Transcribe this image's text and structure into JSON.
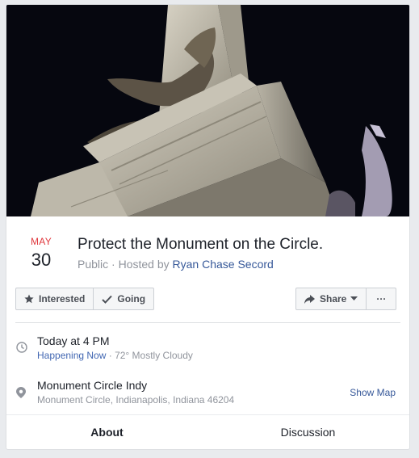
{
  "event": {
    "month": "MAY",
    "day": "30",
    "title": "Protect the Monument on the Circle.",
    "privacy": "Public",
    "hosted_by_label": "· Hosted by",
    "host": "Ryan Chase Secord"
  },
  "actions": {
    "interested_label": "Interested",
    "going_label": "Going",
    "share_label": "Share",
    "more_label": "···"
  },
  "time": {
    "primary": "Today at 4 PM",
    "happening": "Happening Now",
    "weather": "· 72° Mostly Cloudy"
  },
  "location": {
    "name": "Monument Circle Indy",
    "address": "Monument Circle, Indianapolis, Indiana 46204",
    "show_map_label": "Show Map"
  },
  "tabs": {
    "about": "About",
    "discussion": "Discussion"
  },
  "colors": {
    "month_red": "#e0393e",
    "link_blue": "#365899",
    "active_tab": "#4267b2"
  }
}
